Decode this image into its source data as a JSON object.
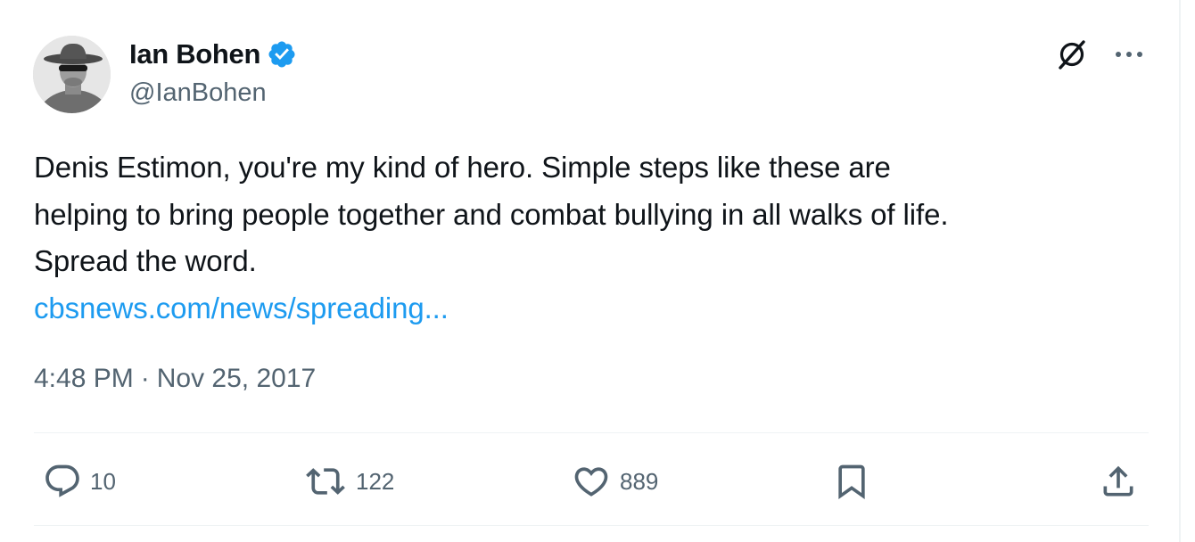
{
  "tweet": {
    "author": {
      "display_name": "Ian Bohen",
      "handle": "@IanBohen",
      "verified": true
    },
    "text_lines": [
      "Denis Estimon, you're my kind of hero. Simple steps like these are",
      "helping to bring people together and combat bullying in all walks of life.",
      "Spread the word."
    ],
    "link_text": "cbsnews.com/news/spreading...",
    "time": "4:48 PM",
    "separator": "·",
    "date": "Nov 25, 2017"
  },
  "actions": {
    "replies": "10",
    "reposts": "122",
    "likes": "889"
  },
  "icons": {
    "verified": "verified-badge-icon",
    "grok": "grok-icon",
    "more": "more-dots-icon",
    "reply": "reply-bubble-icon",
    "repost": "repost-arrows-icon",
    "like": "heart-icon",
    "bookmark": "bookmark-icon",
    "share": "share-upload-icon"
  },
  "colors": {
    "text_primary": "#0f1419",
    "text_secondary": "#536471",
    "link": "#1d9bf0",
    "verified": "#1d9bf0",
    "divider": "#eff3f4"
  }
}
